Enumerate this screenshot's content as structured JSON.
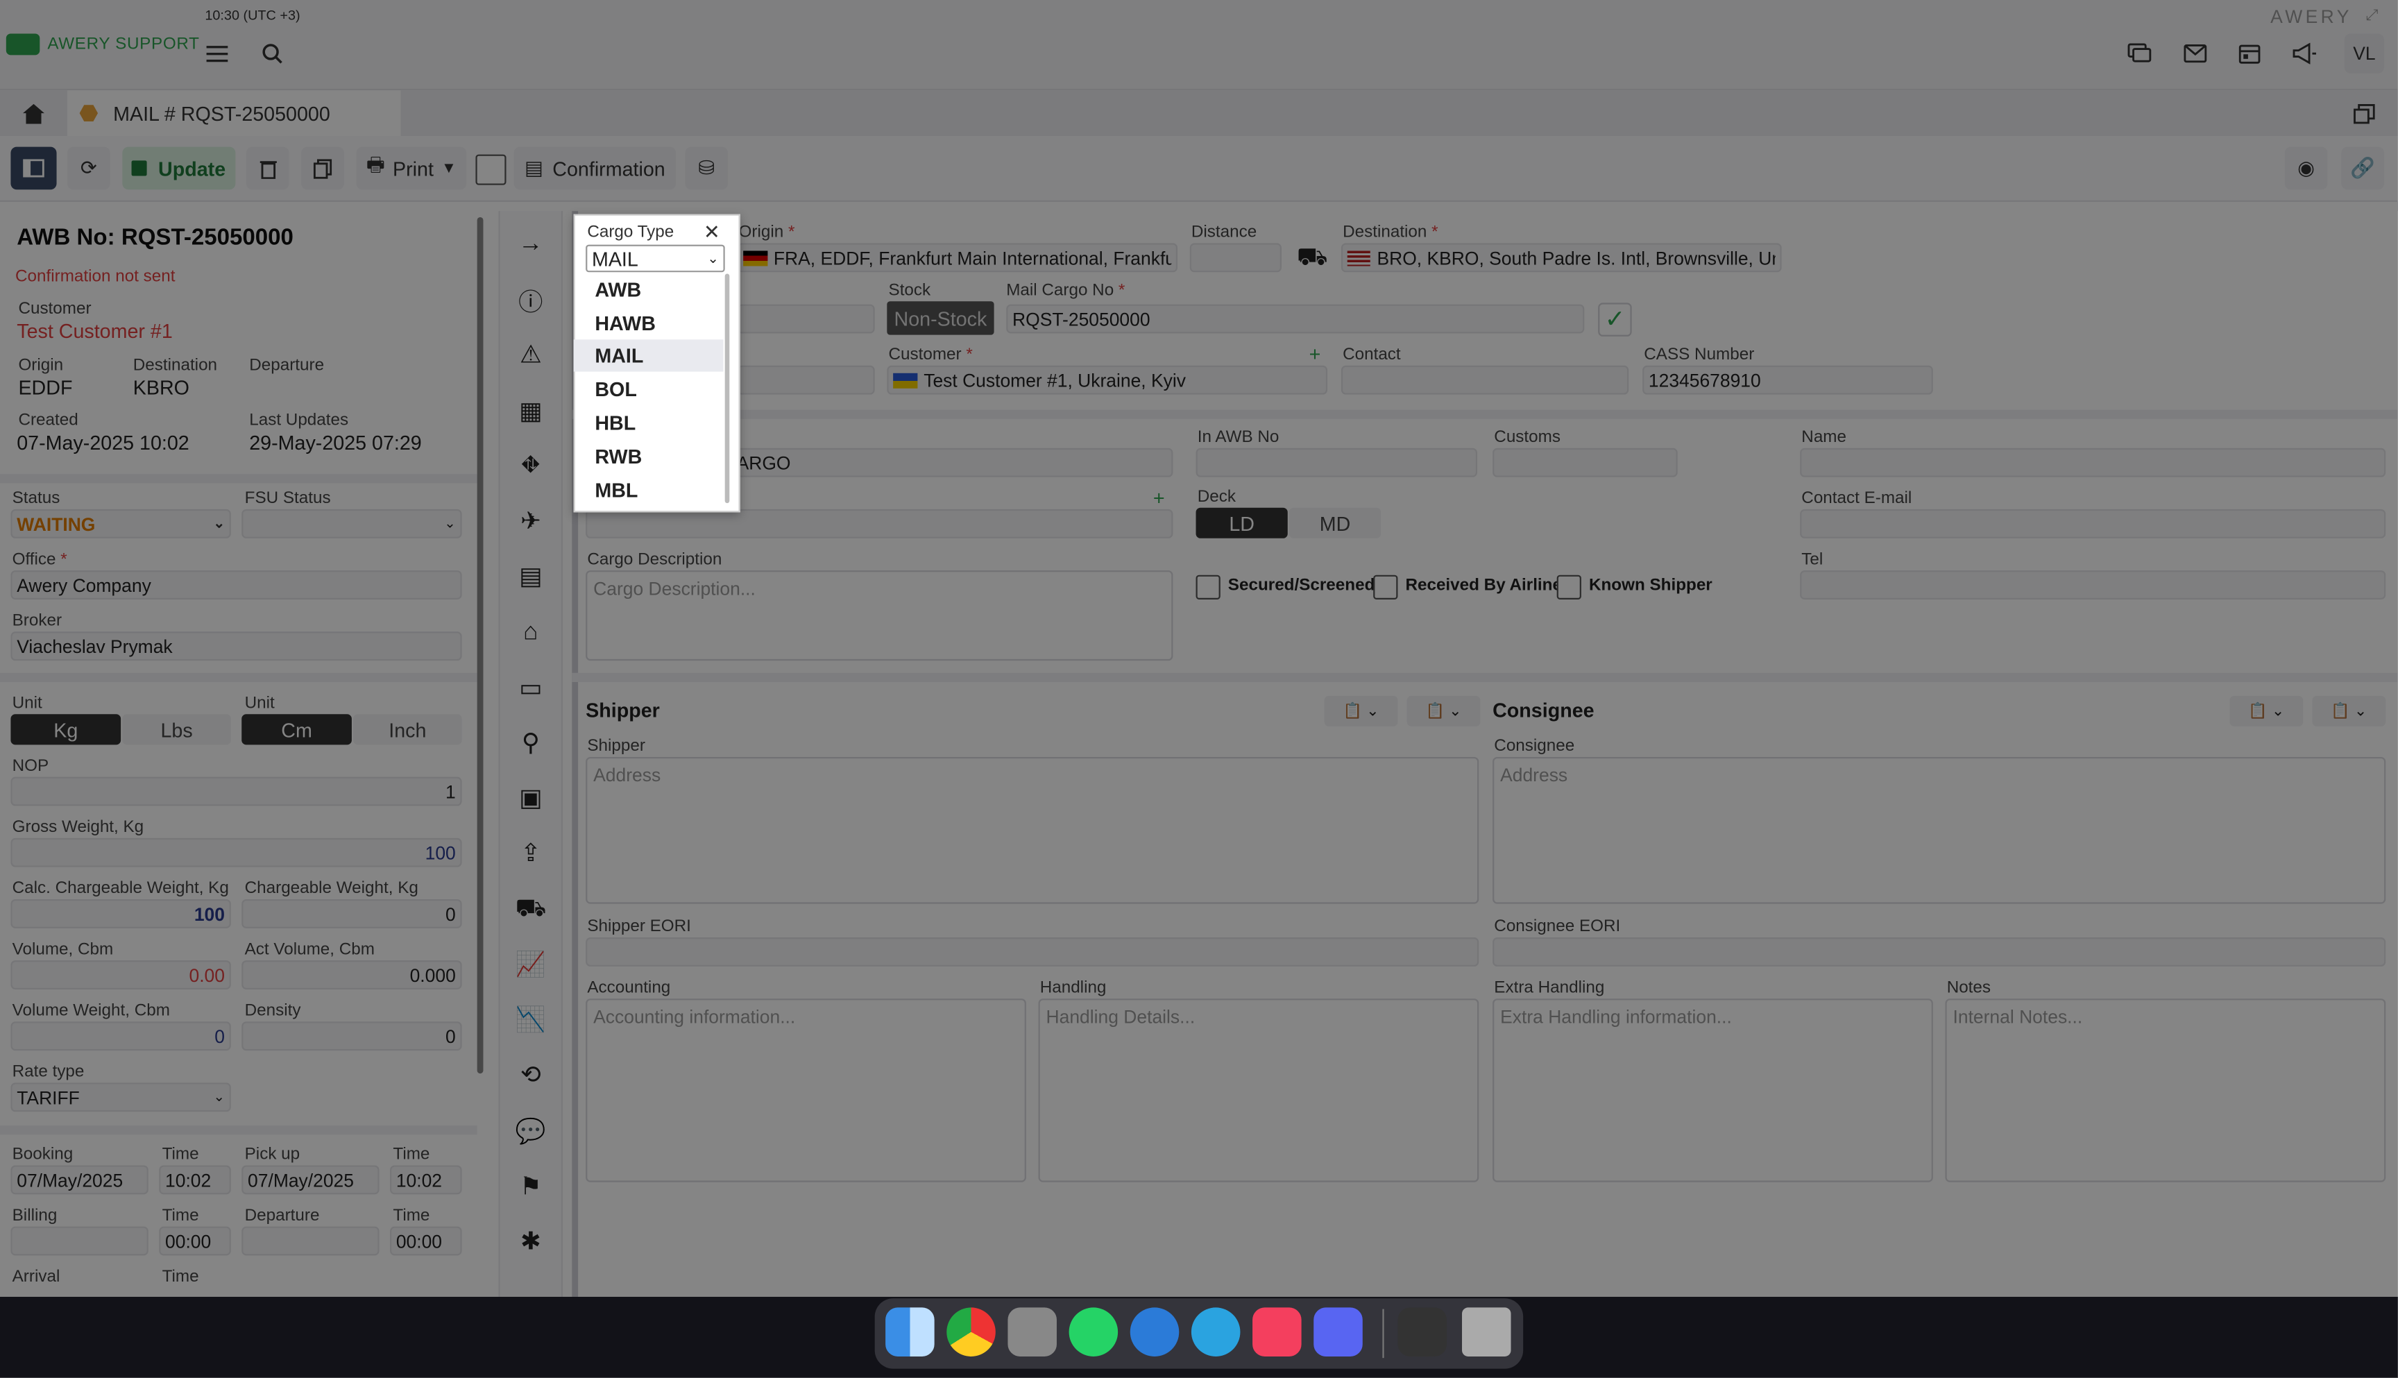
{
  "system": {
    "clock": "10:30 (UTC +3)",
    "vendor": "AWERY",
    "user_initials": "VL"
  },
  "app": {
    "brand": "AWERY SUPPORT"
  },
  "tab": {
    "title": "MAIL # RQST-25050000"
  },
  "toolbar": {
    "update_label": "Update",
    "print_label": "Print",
    "confirmation_label": "Confirmation"
  },
  "left": {
    "awb_title": "AWB No: RQST-25050000",
    "confirmation_status": "Confirmation not sent",
    "customer_label": "Customer",
    "customer": "Test Customer #1",
    "origin_label": "Origin",
    "origin": "EDDF",
    "destination_label": "Destination",
    "destination": "KBRO",
    "departure_label": "Departure",
    "created_label": "Created",
    "created": "07-May-2025 10:02",
    "last_updates_label": "Last Updates",
    "last_updates": "29-May-2025 07:29",
    "status_label": "Status",
    "status": "WAITING",
    "fsu_label": "FSU Status",
    "office_label": "Office",
    "office": "Awery Company",
    "broker_label": "Broker",
    "broker": "Viacheslav Prymak",
    "unit_label": "Unit",
    "unit_weight": [
      "Kg",
      "Lbs"
    ],
    "unit2_label": "Unit",
    "unit_dim": [
      "Cm",
      "Inch"
    ],
    "nop_label": "NOP",
    "nop": "1",
    "gross_label": "Gross Weight, Kg",
    "gross": "100",
    "calc_cw_label": "Calc. Chargeable Weight, Kg",
    "calc_cw": "100",
    "cw_label": "Chargeable Weight, Kg",
    "cw": "0",
    "volume_label": "Volume, Cbm",
    "volume": "0.00",
    "act_volume_label": "Act Volume, Cbm",
    "act_volume": "0.000",
    "vol_weight_label": "Volume Weight, Cbm",
    "vol_weight": "0",
    "density_label": "Density",
    "density": "0",
    "rate_type_label": "Rate type",
    "rate_type": "TARIFF",
    "booking_label": "Booking",
    "booking_date": "07/May/2025",
    "time_label": "Time",
    "booking_time": "10:02",
    "pickup_label": "Pick up",
    "pickup_date": "07/May/2025",
    "pickup_time": "10:02",
    "billing_label": "Billing",
    "billing_time": "00:00",
    "departure2_label": "Departure",
    "departure_time": "00:00",
    "arrival_label": "Arrival"
  },
  "main": {
    "origin_label": "Origin",
    "origin_value": "FRA, EDDF, Frankfurt Main International, Frankfu",
    "distance_label": "Distance",
    "destination_label": "Destination",
    "destination_value": "BRO, KBRO, South Padre Is. Intl, Brownsville, Unit",
    "stock_label": "Stock",
    "stock_value": "Non-Stock",
    "mail_cargo_label": "Mail Cargo No",
    "mail_cargo_value": "RQST-25050000",
    "customer_label": "Customer",
    "customer_value": "Test Customer #1, Ukraine, Kyiv",
    "contact_label": "Contact",
    "cass_label": "CASS Number",
    "cass_value": "12345678910",
    "cargo_partial": "CARGO",
    "in_awb_label": "In AWB No",
    "customs_label": "Customs",
    "name_label": "Name",
    "deck_label": "Deck",
    "deck_options": [
      "LD",
      "MD"
    ],
    "contact_email_label": "Contact E-mail",
    "cargo_desc_label": "Cargo Description",
    "cargo_desc_placeholder": "Cargo Description...",
    "secured_label": "Secured/Screened",
    "received_label": "Received By Airline",
    "known_label": "Known Shipper",
    "tel_label": "Tel",
    "shipper_header": "Shipper",
    "consignee_header": "Consignee",
    "shipper_label": "Shipper",
    "shipper_placeholder": "Address",
    "consignee_label": "Consignee",
    "consignee_placeholder": "Address",
    "shipper_eori_label": "Shipper EORI",
    "consignee_eori_label": "Consignee EORI",
    "accounting_label": "Accounting",
    "accounting_placeholder": "Accounting information...",
    "handling_label": "Handling",
    "handling_placeholder": "Handling Details...",
    "extra_handling_label": "Extra Handling",
    "extra_handling_placeholder": "Extra Handling information...",
    "notes_label": "Notes",
    "notes_placeholder": "Internal Notes..."
  },
  "popup": {
    "title": "Cargo Type",
    "selected": "MAIL",
    "options": [
      "AWB",
      "HAWB",
      "MAIL",
      "BOL",
      "HBL",
      "RWB",
      "MBL"
    ]
  },
  "colors": {
    "accent_green": "#2ea44f",
    "waiting_orange": "#e07b00",
    "error_red": "#e04040"
  }
}
